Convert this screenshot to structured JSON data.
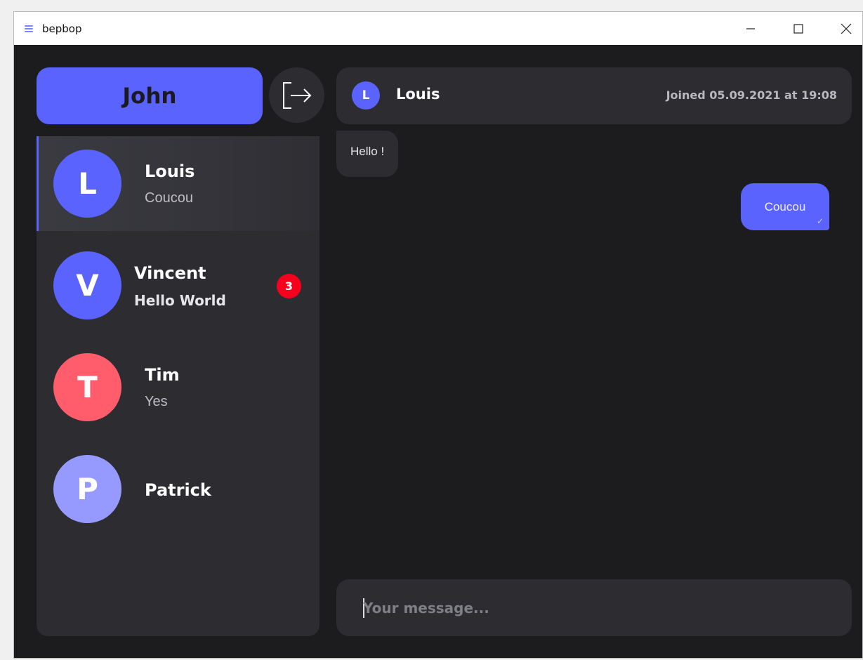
{
  "window": {
    "title": "bepbop",
    "controls": [
      "minimize",
      "maximize",
      "close"
    ]
  },
  "user": {
    "name": "John",
    "logout_icon": "logout-icon"
  },
  "contacts": [
    {
      "name": "Louis",
      "initial": "L",
      "last_message": "Coucou",
      "color": "#5b63fe",
      "active": true,
      "unread": null
    },
    {
      "name": "Vincent",
      "initial": "V",
      "last_message": "Hello World",
      "color": "#5b63fe",
      "active": false,
      "unread": "3"
    },
    {
      "name": "Tim",
      "initial": "T",
      "last_message": "Yes",
      "color": "#ff5c6c",
      "active": false,
      "unread": null
    },
    {
      "name": "Patrick",
      "initial": "P",
      "last_message": "",
      "color": "#969aff",
      "active": false,
      "unread": null
    }
  ],
  "chat": {
    "contact_initial": "L",
    "contact_name": "Louis",
    "joined": "Joined 05.09.2021 at 19:08",
    "messages": [
      {
        "direction": "incoming",
        "text": "Hello !"
      },
      {
        "direction": "outgoing",
        "text": "Coucou",
        "status": "check-icon"
      }
    ]
  },
  "composer": {
    "placeholder": "Your message...",
    "value": ""
  },
  "colors": {
    "accent": "#5b63fe",
    "background": "#1c1c1f",
    "panel": "#2c2c31",
    "badge": "#f7001e"
  }
}
